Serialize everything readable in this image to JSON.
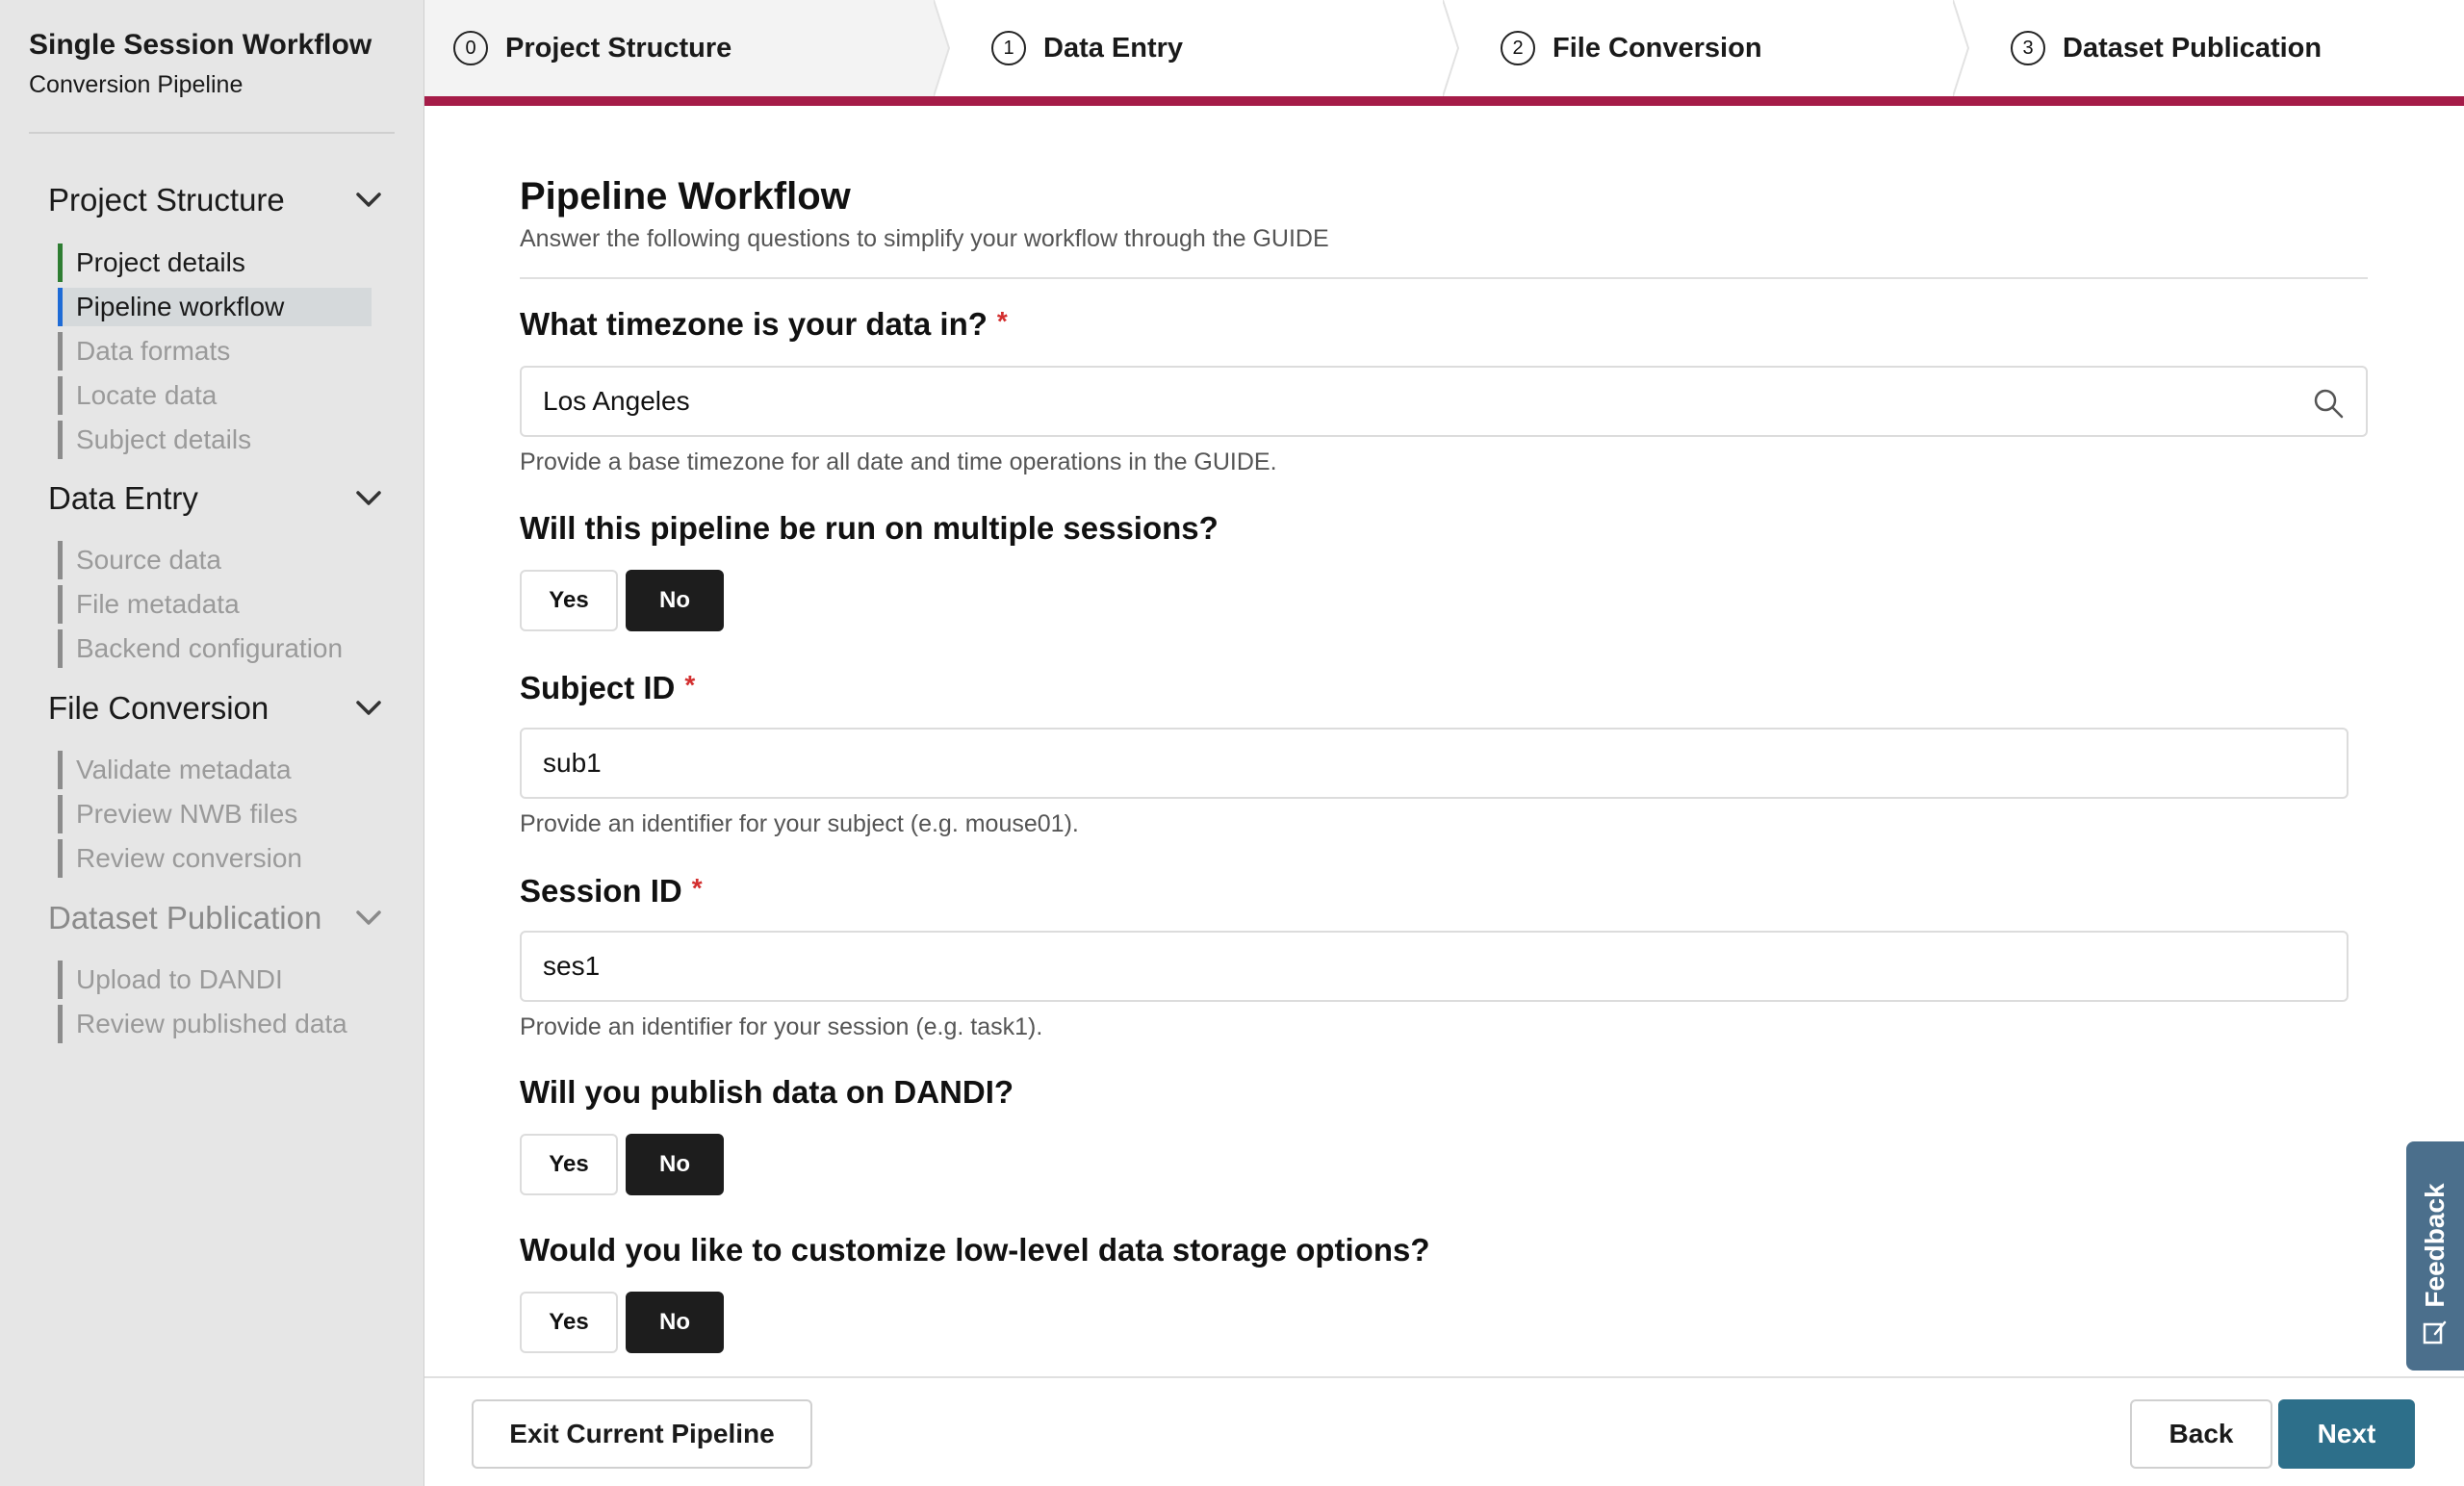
{
  "app": {
    "title": "Single Session Workflow",
    "subtitle": "Conversion Pipeline"
  },
  "sidebar": {
    "sections": [
      {
        "title": "Project Structure",
        "enabled": true,
        "items": [
          {
            "label": "Project details",
            "state": "done"
          },
          {
            "label": "Pipeline workflow",
            "state": "active"
          },
          {
            "label": "Data formats",
            "state": "pending"
          },
          {
            "label": "Locate data",
            "state": "pending"
          },
          {
            "label": "Subject details",
            "state": "pending"
          }
        ]
      },
      {
        "title": "Data Entry",
        "enabled": true,
        "items": [
          {
            "label": "Source data",
            "state": "pending"
          },
          {
            "label": "File metadata",
            "state": "pending"
          },
          {
            "label": "Backend configuration",
            "state": "pending"
          }
        ]
      },
      {
        "title": "File Conversion",
        "enabled": true,
        "items": [
          {
            "label": "Validate metadata",
            "state": "pending"
          },
          {
            "label": "Preview NWB files",
            "state": "pending"
          },
          {
            "label": "Review conversion",
            "state": "pending"
          }
        ]
      },
      {
        "title": "Dataset Publication",
        "enabled": false,
        "items": [
          {
            "label": "Upload to DANDI",
            "state": "pending"
          },
          {
            "label": "Review published data",
            "state": "pending"
          }
        ]
      }
    ]
  },
  "stepper": {
    "steps": [
      {
        "number": "0",
        "label": "Project Structure",
        "current": true
      },
      {
        "number": "1",
        "label": "Data Entry",
        "current": false
      },
      {
        "number": "2",
        "label": "File Conversion",
        "current": false
      },
      {
        "number": "3",
        "label": "Dataset Publication",
        "current": false
      }
    ],
    "accent_color": "#a51c48"
  },
  "main": {
    "title": "Pipeline Workflow",
    "subtitle": "Answer the following questions to simplify your workflow through the GUIDE",
    "timezone": {
      "question": "What timezone is your data in?",
      "required_mark": "*",
      "value": "Los Angeles",
      "help": "Provide a base timezone for all date and time operations in the GUIDE.",
      "icon": "search-icon"
    },
    "multiple_sessions": {
      "question": "Will this pipeline be run on multiple sessions?",
      "yes_label": "Yes",
      "no_label": "No",
      "selected": "No"
    },
    "subject_id": {
      "question": "Subject ID",
      "required_mark": "*",
      "value": "sub1",
      "help": "Provide an identifier for your subject (e.g. mouse01)."
    },
    "session_id": {
      "question": "Session ID",
      "required_mark": "*",
      "value": "ses1",
      "help": "Provide an identifier for your session (e.g. task1)."
    },
    "publish_dandi": {
      "question": "Will you publish data on DANDI?",
      "yes_label": "Yes",
      "no_label": "No",
      "selected": "No"
    },
    "storage_options": {
      "question": "Would you like to customize low-level data storage options?",
      "yes_label": "Yes",
      "no_label": "No",
      "selected": "No"
    }
  },
  "footer": {
    "exit_label": "Exit Current Pipeline",
    "back_label": "Back",
    "next_label": "Next",
    "next_color": "#2d6f8a"
  },
  "feedback": {
    "label": "Feedback",
    "color": "#4b6f8c"
  }
}
